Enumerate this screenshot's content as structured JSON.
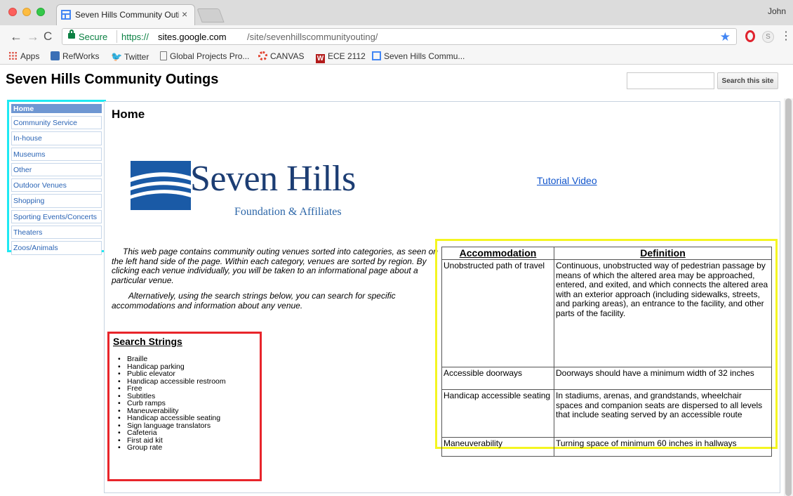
{
  "browser": {
    "tab_title": "Seven Hills Community Outing",
    "tab_close": "×",
    "profile_name": "John",
    "secure_label": "Secure",
    "url_scheme": "https://",
    "url_host": "sites.google.com",
    "url_path": "/site/sevenhillscommunityouting/",
    "bookmarks": [
      {
        "label": "Apps",
        "icon": "apps-grid-icon"
      },
      {
        "label": "RefWorks",
        "icon": "refworks-icon"
      },
      {
        "label": "Twitter",
        "icon": "twitter-bird-icon"
      },
      {
        "label": "Global Projects Pro...",
        "icon": "document-icon"
      },
      {
        "label": "CANVAS",
        "icon": "canvas-icon"
      },
      {
        "label": "ECE 2112",
        "icon": "ece-icon",
        "icon_text": "W"
      },
      {
        "label": "Seven Hills Commu...",
        "icon": "google-sites-icon"
      }
    ],
    "icons": {
      "back": "←",
      "forward": "→",
      "reload": "C",
      "star": "★",
      "menu": "⋮",
      "extension": "S",
      "twitter": "🐦"
    }
  },
  "site": {
    "title": "Seven Hills Community Outings",
    "search_button": "Search this site",
    "search_placeholder": ""
  },
  "sidebar": {
    "items": [
      {
        "label": "Home",
        "active": true
      },
      {
        "label": "Community Service"
      },
      {
        "label": "In-house"
      },
      {
        "label": "Museums"
      },
      {
        "label": "Other"
      },
      {
        "label": "Outdoor Venues"
      },
      {
        "label": "Shopping"
      },
      {
        "label": "Sporting Events/Concerts"
      },
      {
        "label": "Theaters"
      },
      {
        "label": "Zoos/Animals"
      }
    ]
  },
  "content": {
    "heading": "Home",
    "logo": {
      "main": "Seven Hills",
      "sub": "Foundation & Affiliates"
    },
    "tutorial_link": "Tutorial Video",
    "intro_paragraphs": [
      "This web page contains community outing venues sorted into categories, as seen on the left hand side of the page. Within each category, venues are sorted by region. By clicking each venue individually, you will be taken to an informational page about a particular venue.",
      "Alternatively, using the search strings below, you can search for specific accommodations and information about any venue."
    ],
    "search_strings": {
      "heading": "Search Strings",
      "items": [
        "Braille",
        "Handicap parking",
        "Public elevator",
        "Handicap accessible restroom",
        "Free",
        "Subtitles",
        "Curb ramps",
        "Maneuverability",
        "Handicap accessible seating",
        "Sign language translators",
        "Cafeteria",
        "First aid kit",
        "Group rate"
      ]
    },
    "table": {
      "headers": [
        "Accommodation",
        "Definition"
      ],
      "rows": [
        [
          "Unobstructed path of travel",
          "Continuous, unobstructed way of pedestrian passage by means of which the altered area may be approached, entered, and exited, and which connects the altered area with an exterior approach (including sidewalks, streets, and parking areas), an entrance to the facility, and other parts of the facility."
        ],
        [
          "Accessible doorways",
          "Doorways should have a minimum width of 32 inches"
        ],
        [
          "Handicap accessible seating",
          "In stadiums, arenas, and grandstands, wheelchair spaces and companion seats are dispersed to all levels that include seating served by an accessible route"
        ],
        [
          "Maneuverability",
          "Turning space of minimum 60 inches in hallways"
        ]
      ]
    }
  },
  "highlight_colors": {
    "sidebar_box": "#1ee9f2",
    "search_box": "#e8252b",
    "table_box": "#f4f521"
  }
}
